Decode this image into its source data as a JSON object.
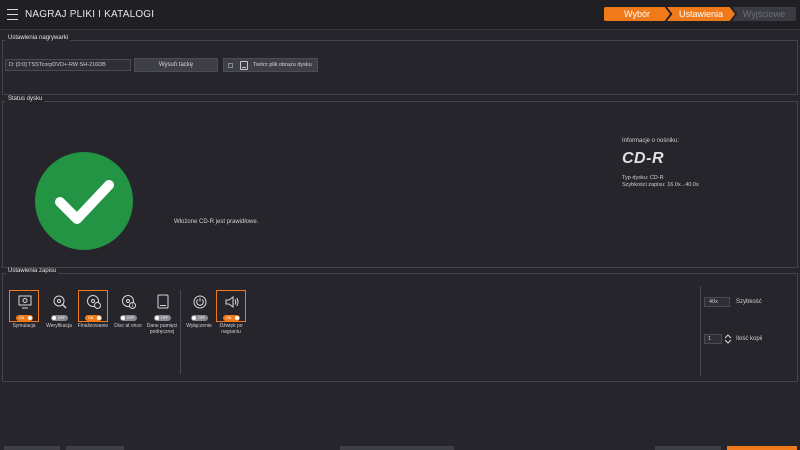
{
  "app": {
    "title": "NAGRAJ PLIKI I KATALOGI"
  },
  "breadcrumb": {
    "step1": "Wybór",
    "step2": "Ustawienia",
    "step3": "Wyjściowe"
  },
  "recorder": {
    "title": "Ustawienia nagrywarki",
    "drive": "D: [0:0] TSSTcorpDVD+-RW SH-216DB",
    "eject_label": "Wysuń tackę",
    "image_label": "Twórz plik obrazu dysku"
  },
  "disk_status": {
    "title": "Status dysku",
    "message": "Włożone CD-R jest prawidłowe.",
    "media_info_label": "Informacje o nośniku:",
    "media_name": "CD-R",
    "disk_type": "Typ dysku: CD-R",
    "write_speeds": "Szybkości zapisu: 16.0x...40.0x"
  },
  "write_settings": {
    "title": "Ustawienia zapisu",
    "toggle_on": "ON",
    "toggle_off": "OFF",
    "options": [
      {
        "label": "Symulacja",
        "state": "ON",
        "icon": "simulation-icon"
      },
      {
        "label": "Weryfikacja",
        "state": "OFF",
        "icon": "verify-icon"
      },
      {
        "label": "Finalizowanie",
        "state": "ON",
        "icon": "finalize-icon"
      },
      {
        "label": "Disc at once",
        "state": "OFF",
        "icon": "disc-at-once-icon"
      },
      {
        "label": "Dane pamięci podręcznej",
        "state": "OFF",
        "icon": "cache-icon"
      },
      {
        "label": "Wyłączenie",
        "state": "OFF",
        "icon": "power-icon"
      },
      {
        "label": "Dźwięk po nagraniu",
        "state": "ON",
        "icon": "speaker-icon"
      }
    ],
    "speed_value": "40x",
    "speed_label": "Szybkość",
    "copies_value": "1",
    "copies_label": "Ilość kopii"
  },
  "colors": {
    "accent": "#f07a19",
    "success": "#239443",
    "background": "#25252b"
  }
}
